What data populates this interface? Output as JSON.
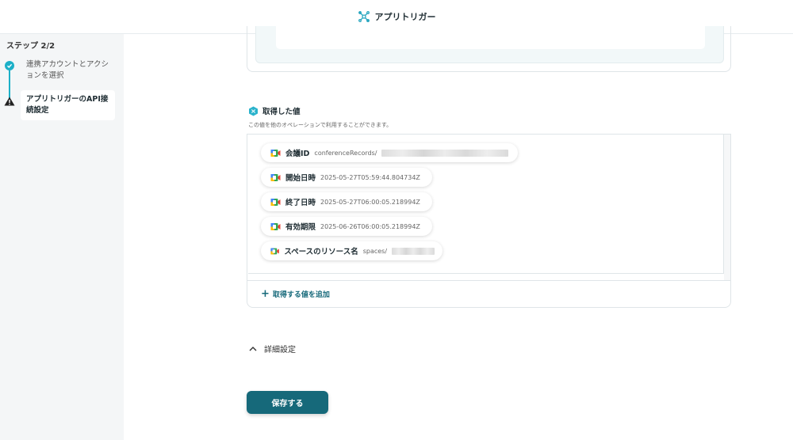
{
  "header": {
    "title": "アプリトリガー",
    "icon": "trigger-icon"
  },
  "sidebar": {
    "step_count": "ステップ 2/2",
    "steps": [
      {
        "label": "連携アカウントとアクションを選択",
        "status": "done"
      },
      {
        "label": "アプリトリガーのAPI接続設定",
        "status": "warning"
      }
    ]
  },
  "acquired": {
    "title": "取得した値",
    "description": "この値を他のオペレーションで利用することができます。",
    "items": [
      {
        "label": "会議ID",
        "value": "conferenceRecords/"
      },
      {
        "label": "開始日時",
        "value": "2025-05-27T05:59:44.804734Z"
      },
      {
        "label": "終了日時",
        "value": "2025-05-27T06:00:05.218994Z"
      },
      {
        "label": "有効期限",
        "value": "2025-06-26T06:00:05.218994Z"
      },
      {
        "label": "スペースのリソース名",
        "value": "spaces/"
      }
    ],
    "add_label": "取得する値を追加"
  },
  "details": {
    "label": "詳細設定"
  },
  "save_label": "保存する",
  "colors": {
    "accent": "#1cb0c8",
    "primary": "#16697a",
    "sidebar_bg": "#f4f6f7"
  }
}
